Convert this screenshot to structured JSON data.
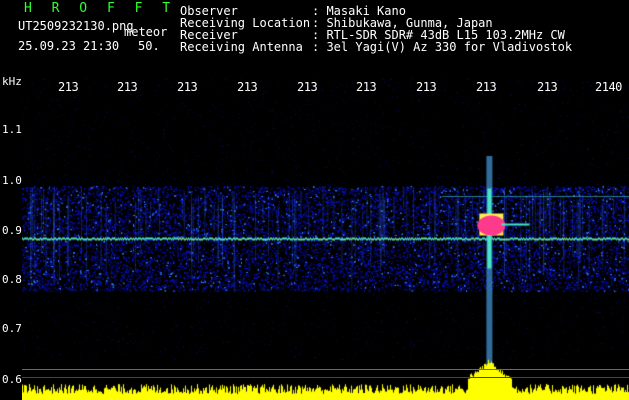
{
  "header": {
    "app_title": "H R O F F T",
    "filename": "UT2509232130.png",
    "event_type": "meteor",
    "datetime": "25.09.23 21:30",
    "count": "50.",
    "fields": [
      {
        "key": "Observer",
        "value": ": Masaki Kano"
      },
      {
        "key": "Receiving Location",
        "value": ": Shibukawa, Gunma, Japan"
      },
      {
        "key": "Receiver",
        "value": ": RTL-SDR SDR# 43dB L15 103.2MHz CW"
      },
      {
        "key": "Receiving Antenna",
        "value": ": 3el Yagi(V) Az 330 for Vladivostok"
      }
    ]
  },
  "axes": {
    "y_unit": "kHz",
    "y_ticks": [
      "1.1",
      "1.0",
      "0.9",
      "0.8",
      "0.7",
      "0.6"
    ],
    "x_ticks": [
      "213",
      "213",
      "213",
      "213",
      "213",
      "213",
      "213",
      "213",
      "213",
      "2140"
    ]
  },
  "colors": {
    "background": "#000000",
    "noise_low": "#0a14b4",
    "noise_mid": "#2a7cff",
    "carrier": "#46e6c8",
    "echo_peak": "#ff3a8c",
    "amplitude": "#ffff00",
    "text": "#ffffff",
    "title": "#33ff33"
  },
  "spectrogram": {
    "noise_band_khz": [
      0.78,
      0.99
    ],
    "carrier_khz": 0.885,
    "meteor_echo": {
      "time_fraction": 0.77,
      "khz": 0.915
    }
  }
}
